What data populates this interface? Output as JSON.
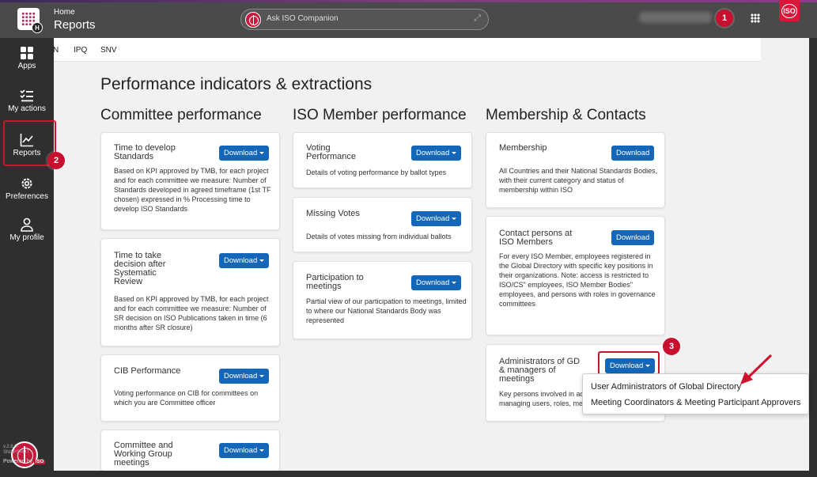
{
  "header": {
    "breadcrumb": "Home",
    "title": "Reports",
    "companion_placeholder": "Ask ISO Companion",
    "user_email": "••••••••••@iso.org",
    "iso_logo": "ISO"
  },
  "sidebar": {
    "items": [
      {
        "label": "Apps",
        "icon": "apps-icon"
      },
      {
        "label": "My actions",
        "icon": "checklist-icon"
      },
      {
        "label": "Reports",
        "icon": "chart-icon"
      },
      {
        "label": "Preferences",
        "icon": "gear-icon"
      },
      {
        "label": "My profile",
        "icon": "person-icon"
      }
    ],
    "version": "v.2.8.0-SNAPSHOT",
    "powered_by": "Powered by",
    "powered_logo": "ISO"
  },
  "tabs": [
    "N",
    "IPQ",
    "SNV"
  ],
  "page_title": "Performance indicators & extractions",
  "columns": [
    {
      "title": "Committee performance",
      "cards": [
        {
          "title": "Time to develop Standards",
          "button": "Download",
          "desc": "Based on KPI approved by TMB, for each project and for each committee we measure: Number of Standards developed in agreed timeframe (1st TF chosen) expressed in % Processing time to develop ISO Standards"
        },
        {
          "title": "Time to take decision after Systematic Review",
          "button": "Download",
          "desc": "Based on KPI approved by TMB, for each project and for each committee we measure: Number of SR decision on ISO Publications taken in time (6 months after SR closure)"
        },
        {
          "title": "CIB Performance",
          "button": "Download",
          "desc": "Voting performance on CIB for committees on which you are Committee officer"
        },
        {
          "title": "Committee and Working Group meetings",
          "button": "Download",
          "desc": ""
        }
      ]
    },
    {
      "title": "ISO Member performance",
      "cards": [
        {
          "title": "Voting Performance",
          "button": "Download",
          "desc": "Details of voting performance by ballot types"
        },
        {
          "title": "Missing Votes",
          "button": "Download",
          "desc": "Details of votes missing from individual ballots"
        },
        {
          "title": "Participation to meetings",
          "button": "Download",
          "desc": "Partial view of our participation to meetings, limited to where our National Standards Body was represented"
        }
      ]
    },
    {
      "title": "Membership & Contacts",
      "cards": [
        {
          "title": "Membership",
          "button": "Download",
          "desc": "All Countries and their National Standards Bodies, with their current category and status of membership within ISO"
        },
        {
          "title": "Contact persons at ISO Members",
          "button": "Download",
          "desc": "For every ISO Member, employees registered in the Global Directory with specific key positions in their organizations. Note: access is restricted to ISO/CS\" employees, ISO Member Bodies\" employees, and persons with roles in governance committees"
        },
        {
          "title": "Administrators of GD & managers of meetings",
          "button": "Download",
          "desc": "Key persons involved in ad managing users, roles, me"
        }
      ]
    }
  ],
  "dropdown": {
    "items": [
      "User Administrators of Global Directory",
      "Meeting Coordinators & Meeting Participant Approvers"
    ]
  },
  "annotations": [
    "1",
    "2",
    "3"
  ],
  "colors": {
    "accent_blue": "#1366b8",
    "highlight_red": "#d0122c",
    "sidebar": "#2f2f2f",
    "topbar": "#4a4a4a"
  }
}
